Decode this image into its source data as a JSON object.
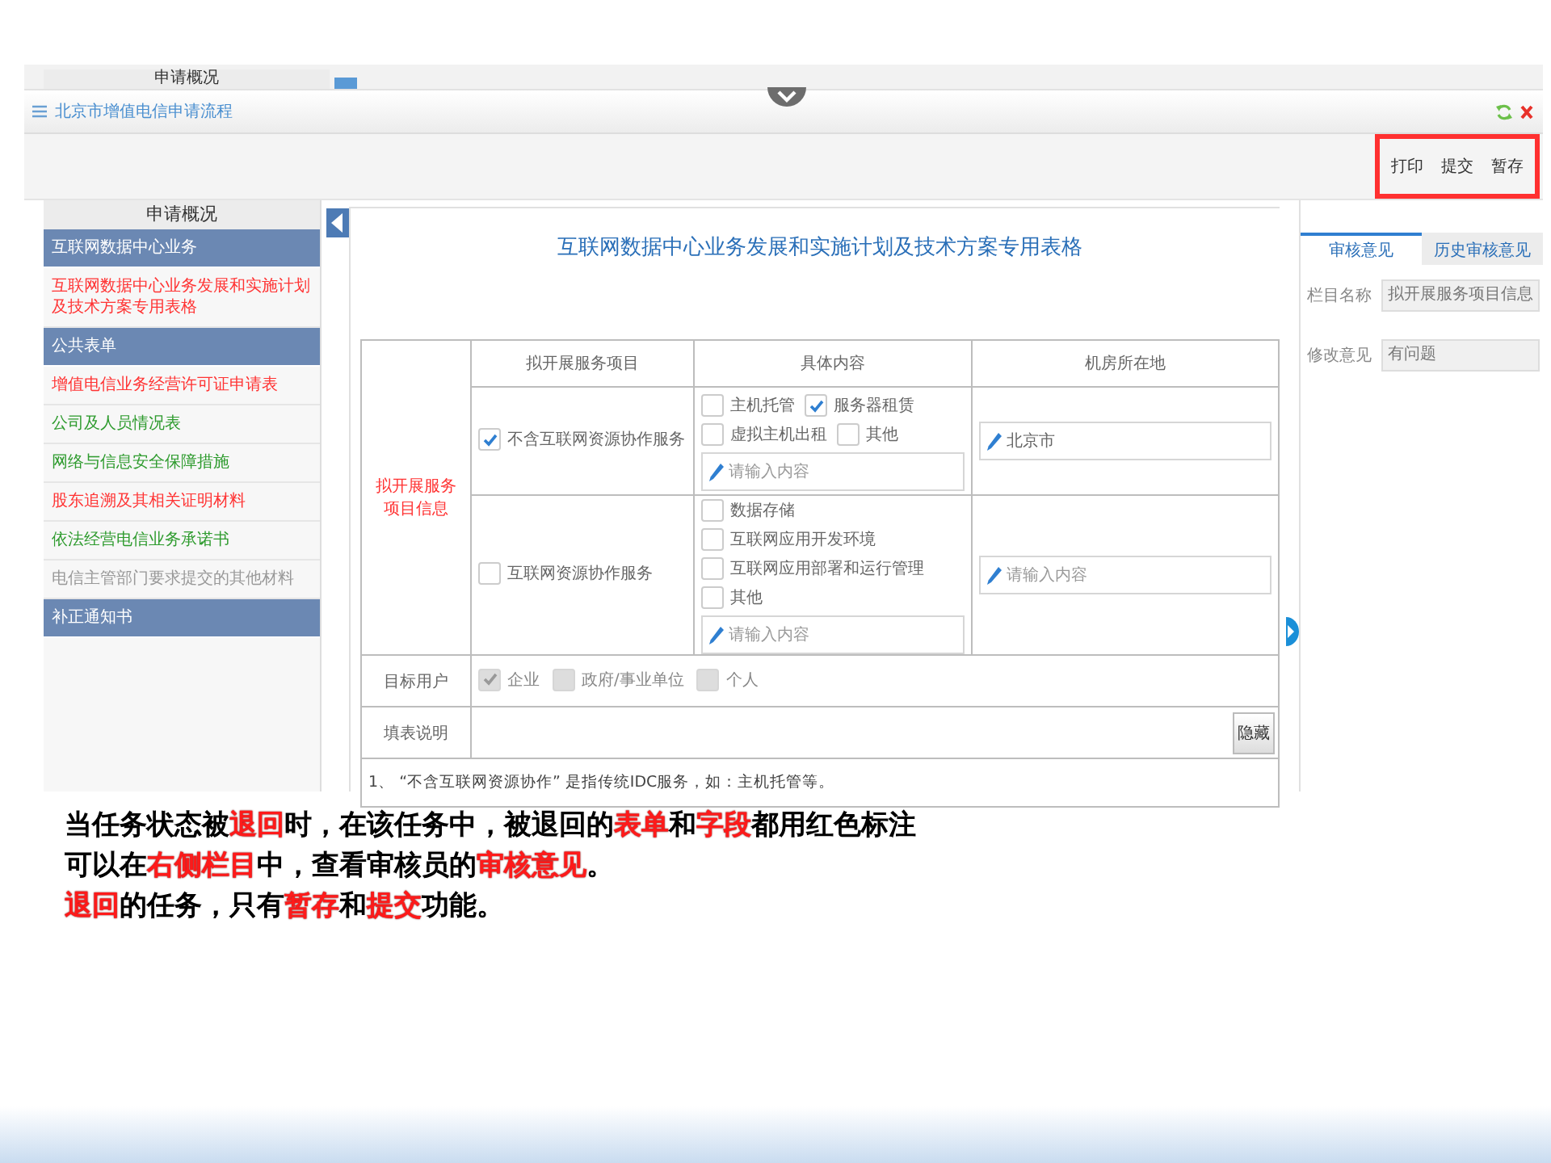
{
  "ghost_strip": {
    "label": "申请概况"
  },
  "window": {
    "title": "北京市增值电信申请流程"
  },
  "toolbar": {
    "highlighted": true,
    "buttons": [
      "打印",
      "提交",
      "暂存"
    ]
  },
  "sidebar": {
    "title": "申请概况",
    "items": [
      {
        "kind": "group",
        "label": "互联网数据中心业务"
      },
      {
        "kind": "item",
        "label": "互联网数据中心业务发展和实施计划及技术方案专用表格",
        "color": "#ff3333"
      },
      {
        "kind": "group",
        "label": "公共表单"
      },
      {
        "kind": "item",
        "label": "增值电信业务经营许可证申请表",
        "color": "#ff3333"
      },
      {
        "kind": "item",
        "label": "公司及人员情况表",
        "color": "#2e9b2e"
      },
      {
        "kind": "item",
        "label": "网络与信息安全保障措施",
        "color": "#2e9b2e"
      },
      {
        "kind": "item",
        "label": "股东追溯及其相关证明材料",
        "color": "#ff3333"
      },
      {
        "kind": "item",
        "label": "依法经营电信业务承诺书",
        "color": "#2e9b2e"
      },
      {
        "kind": "item",
        "label": "电信主管部门要求提交的其他材料",
        "color": "#999999"
      },
      {
        "kind": "group",
        "label": "补正通知书"
      }
    ]
  },
  "form": {
    "title": "互联网数据中心业务发展和实施计划及技术方案专用表格",
    "columns": [
      "拟开展服务项目",
      "具体内容",
      "机房所在地"
    ],
    "group_label": "拟开展服务项目信息",
    "services": [
      {
        "label": "不含互联网资源协作服务",
        "checked": true,
        "options": [
          {
            "label": "主机托管",
            "checked": false
          },
          {
            "label": "服务器租赁",
            "checked": true
          },
          {
            "label": "虚拟主机出租",
            "checked": false
          },
          {
            "label": "其他",
            "checked": false
          }
        ],
        "detail": {
          "placeholder": "请输入内容"
        },
        "location": {
          "value": "北京市"
        }
      },
      {
        "label": "互联网资源协作服务",
        "checked": false,
        "options": [
          {
            "label": "数据存储",
            "checked": false
          },
          {
            "label": "互联网应用开发环境",
            "checked": false
          },
          {
            "label": "互联网应用部署和运行管理",
            "checked": false
          },
          {
            "label": "其他",
            "checked": false
          }
        ],
        "detail": {
          "placeholder": "请输入内容"
        },
        "location": {
          "placeholder": "请输入内容"
        }
      }
    ],
    "target_users": {
      "label": "目标用户",
      "options": [
        {
          "label": "企业",
          "checked": true,
          "disabled": true
        },
        {
          "label": "政府/事业单位",
          "checked": false,
          "disabled": true
        },
        {
          "label": "个人",
          "checked": false,
          "disabled": true
        }
      ]
    },
    "instructions": {
      "label": "填表说明",
      "button": "隐藏"
    },
    "note": "1、 “不含互联网资源协作” 是指传统IDC服务，如：主机托管等。"
  },
  "review": {
    "tabs": [
      {
        "label": "审核意见",
        "selected": true
      },
      {
        "label": "历史审核意见",
        "selected": false
      }
    ],
    "fields": [
      {
        "label": "栏目名称",
        "value": "拟开展服务项目信息"
      },
      {
        "label": "修改意见",
        "value": "有问题"
      }
    ]
  },
  "caption": {
    "lines": [
      [
        {
          "text": "当任务状态被",
          "red": false
        },
        {
          "text": "退回",
          "red": true
        },
        {
          "text": "时，在该任务中，被退回的",
          "red": false
        },
        {
          "text": "表单",
          "red": true
        },
        {
          "text": "和",
          "red": false
        },
        {
          "text": "字段",
          "red": true
        },
        {
          "text": "都用红色标注",
          "red": false
        }
      ],
      [
        {
          "text": "可以在",
          "red": false
        },
        {
          "text": "右侧栏目",
          "red": true
        },
        {
          "text": "中，查看审核员的",
          "red": false
        },
        {
          "text": "审核意见",
          "red": true
        },
        {
          "text": "。",
          "red": false
        }
      ],
      [
        {
          "text": "退回",
          "red": true
        },
        {
          "text": "的任务，只有",
          "red": false
        },
        {
          "text": "暂存",
          "red": true
        },
        {
          "text": "和",
          "red": false
        },
        {
          "text": "提交",
          "red": true
        },
        {
          "text": "功能。",
          "red": false
        }
      ]
    ]
  }
}
